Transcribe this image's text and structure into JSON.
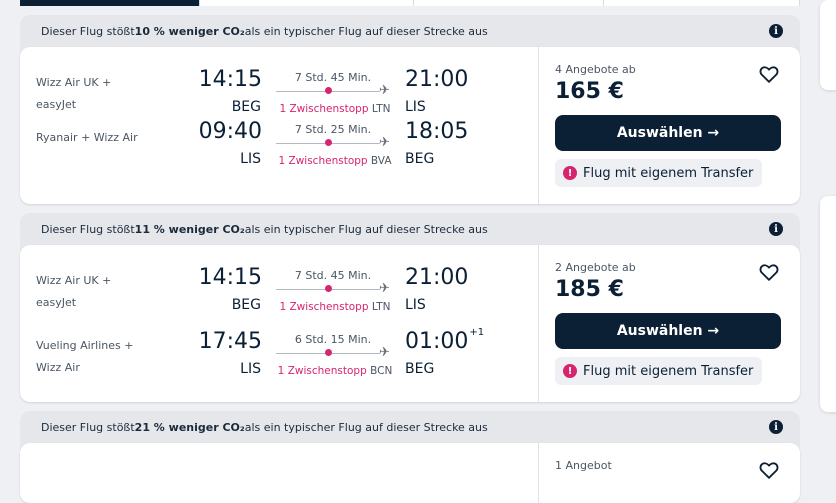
{
  "cards": [
    {
      "eco": {
        "pre": "Dieser Flug stößt ",
        "bold": "10 % weniger CO₂",
        "post": " als ein typischer Flug auf dieser Strecke aus"
      },
      "legs": [
        {
          "airline_1": "Wizz Air UK +",
          "airline_2": "easyJet",
          "dep_time": "14:15",
          "dep_ap": "BEG",
          "duration": "7 Std. 45 Min.",
          "stops": "1 Zwischenstopp",
          "via": "LTN",
          "arr_time": "21:00",
          "arr_plus": "",
          "arr_ap": "LIS"
        },
        {
          "airline_1": "Ryanair + Wizz Air",
          "airline_2": "",
          "dep_time": "09:40",
          "dep_ap": "LIS",
          "duration": "7 Std. 25 Min.",
          "stops": "1 Zwischenstopp",
          "via": "BVA",
          "arr_time": "18:05",
          "arr_plus": "",
          "arr_ap": "BEG"
        }
      ],
      "offers": "4 Angebote ab",
      "price": "165 €",
      "select_label": "Auswählen →",
      "transfer": "Flug mit eigenem Transfer"
    },
    {
      "eco": {
        "pre": "Dieser Flug stößt ",
        "bold": "11 % weniger CO₂",
        "post": " als ein typischer Flug auf dieser Strecke aus"
      },
      "legs": [
        {
          "airline_1": "Wizz Air UK +",
          "airline_2": "easyJet",
          "dep_time": "14:15",
          "dep_ap": "BEG",
          "duration": "7 Std. 45 Min.",
          "stops": "1 Zwischenstopp",
          "via": "LTN",
          "arr_time": "21:00",
          "arr_plus": "",
          "arr_ap": "LIS"
        },
        {
          "airline_1": "Vueling Airlines +",
          "airline_2": "Wizz Air",
          "dep_time": "17:45",
          "dep_ap": "LIS",
          "duration": "6 Std. 15 Min.",
          "stops": "1 Zwischenstopp",
          "via": "BCN",
          "arr_time": "01:00",
          "arr_plus": "+1",
          "arr_ap": "BEG"
        }
      ],
      "offers": "2 Angebote ab",
      "price": "185 €",
      "select_label": "Auswählen →",
      "transfer": "Flug mit eigenem Transfer"
    },
    {
      "eco": {
        "pre": "Dieser Flug stößt ",
        "bold": "21 % weniger CO₂",
        "post": " als ein typischer Flug auf dieser Strecke aus"
      },
      "offers": "1 Angebot"
    }
  ],
  "icons": {
    "info": "info-icon",
    "heart": "heart-icon",
    "alert": "alert-icon",
    "plane": "plane-icon"
  },
  "colors": {
    "navy": "#0b1f35",
    "pink": "#d6246e"
  }
}
